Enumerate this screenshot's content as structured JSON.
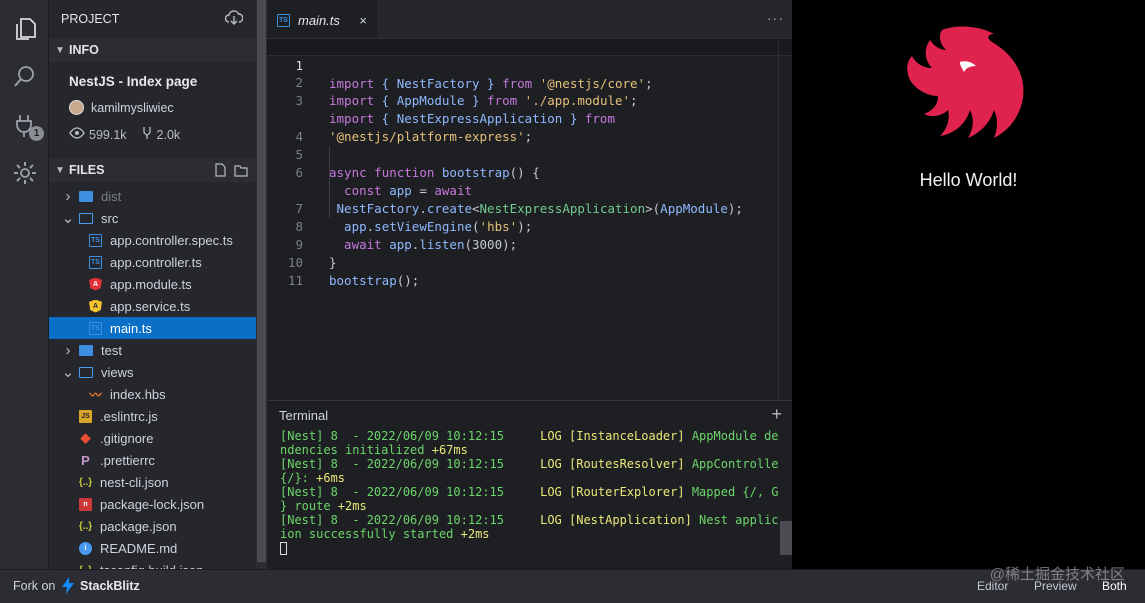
{
  "sidebar": {
    "project_header": "PROJECT",
    "info_header": "INFO",
    "project_title": "NestJS - Index page",
    "author": "kamilmysliwiec",
    "views": "599.1k",
    "forks": "2.0k",
    "files_header": "FILES",
    "files": [
      {
        "label": "dist",
        "type": "folder",
        "state": "collapsed",
        "depth": 0,
        "dimmed": true
      },
      {
        "label": "src",
        "type": "folder",
        "state": "expanded",
        "depth": 0
      },
      {
        "label": "app.controller.spec.ts",
        "type": "ts",
        "depth": 1
      },
      {
        "label": "app.controller.ts",
        "type": "ts",
        "depth": 1
      },
      {
        "label": "app.module.ts",
        "type": "angular",
        "depth": 1
      },
      {
        "label": "app.service.ts",
        "type": "service",
        "depth": 1
      },
      {
        "label": "main.ts",
        "type": "ts",
        "depth": 1,
        "selected": true
      },
      {
        "label": "test",
        "type": "folder",
        "state": "collapsed",
        "depth": 0
      },
      {
        "label": "views",
        "type": "folder",
        "state": "expanded",
        "depth": 0
      },
      {
        "label": "index.hbs",
        "type": "hbs",
        "depth": 1
      },
      {
        "label": ".eslintrc.js",
        "type": "js",
        "depth": 0
      },
      {
        "label": ".gitignore",
        "type": "git",
        "depth": 0
      },
      {
        "label": ".prettierrc",
        "type": "prettier",
        "depth": 0
      },
      {
        "label": "nest-cli.json",
        "type": "json",
        "depth": 0
      },
      {
        "label": "package-lock.json",
        "type": "npm",
        "depth": 0
      },
      {
        "label": "package.json",
        "type": "json",
        "depth": 0
      },
      {
        "label": "README.md",
        "type": "info",
        "depth": 0
      },
      {
        "label": "tsconfig.build.json",
        "type": "json",
        "depth": 0
      }
    ]
  },
  "activity": {
    "badge": "1",
    "icons": [
      "files-icon",
      "search-icon",
      "plug-icon",
      "gear-icon"
    ]
  },
  "editor": {
    "tab_title": "main.ts",
    "tab_close": "×",
    "more": "···",
    "line_numbers": [
      "1",
      "2",
      "3",
      "",
      "4",
      "5",
      "6",
      "",
      "7",
      "8",
      "9",
      "10",
      "11"
    ],
    "code": {
      "l1a": "import",
      "l1b": " { NestFactory } ",
      "l1c": "from",
      "l1d": " '@nestjs/core'",
      "l1e": ";",
      "l2a": "import",
      "l2b": " { AppModule } ",
      "l2c": "from",
      "l2d": " './app.module'",
      "l2e": ";",
      "l3a": "import",
      "l3b": " { NestExpressApplication } ",
      "l3c": "from",
      "l3d": "'@nestjs/platform-express'",
      "l3e": ";",
      "l5a": "async",
      "l5b": " function",
      "l5c": " bootstrap",
      "l5d": "() {",
      "l6a": "  const",
      "l6b": " app",
      "l6c": " = ",
      "l6d": "await",
      "l6e": " NestFactory",
      "l6f": ".",
      "l6g": "create",
      "l6h": "<",
      "l6i": "NestExpressApplication",
      "l6j": ">(",
      "l6k": "AppModule",
      "l6l": ");",
      "l7a": "  app",
      "l7b": ".",
      "l7c": "setViewEngine",
      "l7d": "(",
      "l7e": "'hbs'",
      "l7f": ");",
      "l8a": "  await",
      "l8b": " app",
      "l8c": ".",
      "l8d": "listen",
      "l8e": "(3000);",
      "l9": "}",
      "l10a": "bootstrap",
      "l10b": "();"
    }
  },
  "terminal": {
    "title": "Terminal",
    "add": "+",
    "lines": [
      {
        "a": "[Nest] 8  - 2022/06/09 10:12:15     ",
        "b": "LOG",
        "c": " [InstanceLoader]",
        "d": " AppModule depe"
      },
      {
        "a": "ndencies initialized",
        "b": " +67ms"
      },
      {
        "a": "[Nest] 8  - 2022/06/09 10:12:15     ",
        "b": "LOG",
        "c": " [RoutesResolver]",
        "d": " AppController"
      },
      {
        "a": "{/}:",
        "b": " +6ms"
      },
      {
        "a": "[Nest] 8  - 2022/06/09 10:12:15     ",
        "b": "LOG",
        "c": " [RouterExplorer]",
        "d": " Mapped {/, GET"
      },
      {
        "a": "} route",
        "b": " +2ms"
      },
      {
        "a": "[Nest] 8  - 2022/06/09 10:12:15     ",
        "b": "LOG",
        "c": " [NestApplication]",
        "d": " Nest applicat"
      },
      {
        "a": "ion successfully started",
        "b": " +2ms"
      }
    ]
  },
  "preview": {
    "heading": "Hello World!"
  },
  "footer": {
    "fork_label": "Fork on",
    "brand": "StackBlitz",
    "editor_btn": "Editor",
    "preview_btn": "Preview",
    "both_btn": "Both",
    "watermark": "@稀土掘金技术社区"
  },
  "colors": {
    "accent": "#0b6fc7",
    "nest_red": "#e0234e"
  }
}
